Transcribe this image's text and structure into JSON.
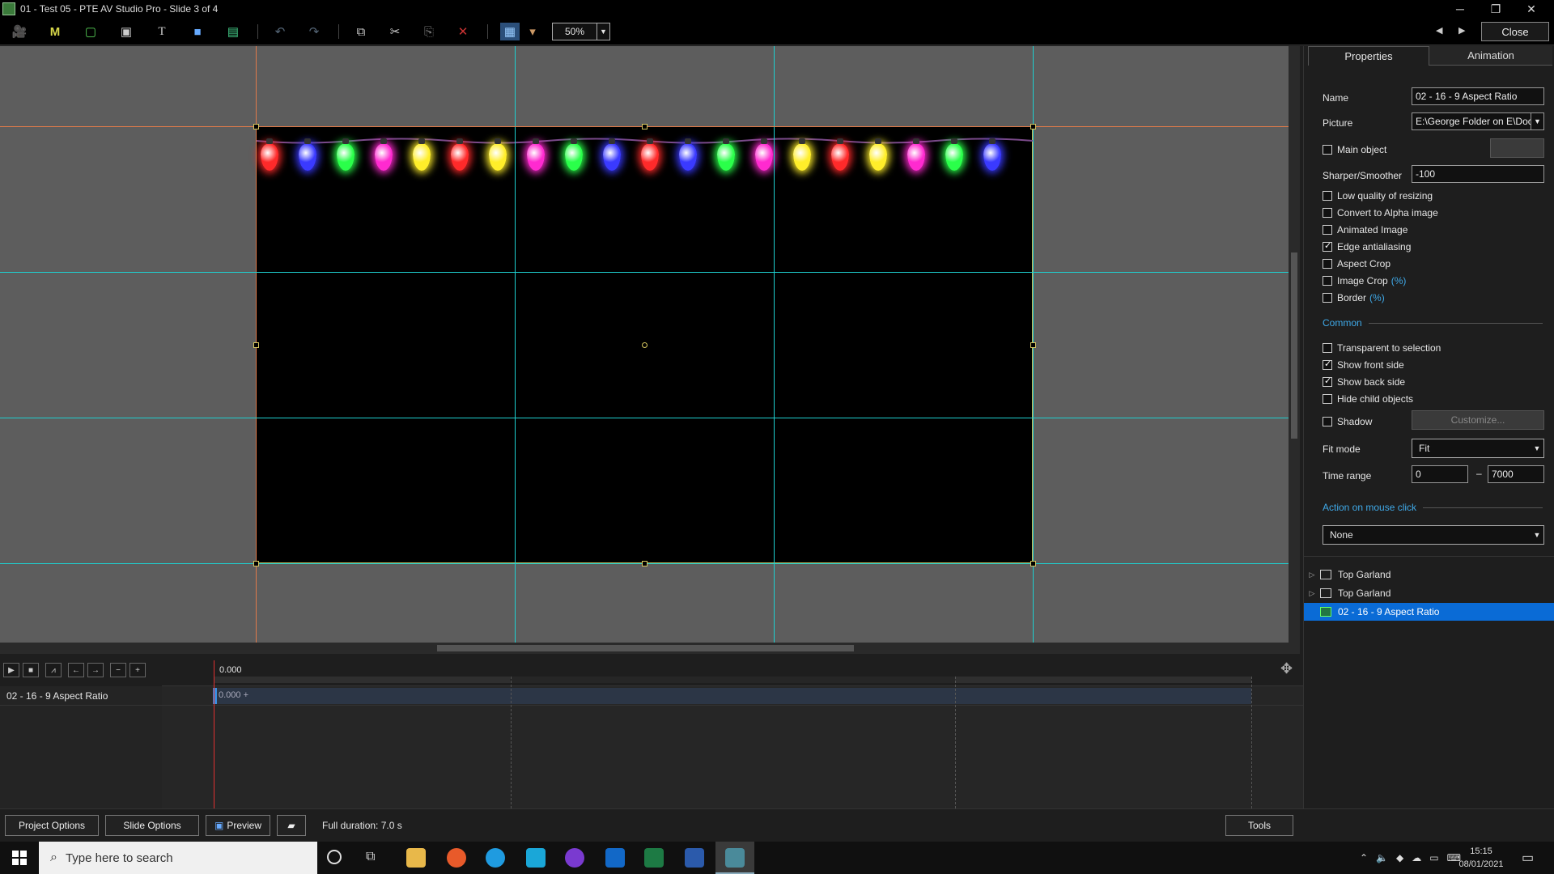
{
  "window": {
    "title": "01 - Test 05 - PTE AV Studio Pro - Slide 3 of 4",
    "minimize": "─",
    "restore": "❐",
    "close": "✕"
  },
  "toolbar": {
    "zoom": "50%",
    "close_label": "Close",
    "prev_arrow": "◀",
    "next_arrow": "▶",
    "icons": {
      "camera": "🎥",
      "mask": "M",
      "frame": "▢",
      "video": "▣",
      "text": "T",
      "rect": "■",
      "image": "▤",
      "undo": "↶",
      "redo": "↷",
      "copy": "⧉",
      "cut": "✂",
      "paste": "⎘",
      "delete": "✕",
      "grid": "▦",
      "grid_dropdown": "▾"
    }
  },
  "properties": {
    "tabs": [
      "Properties",
      "Animation"
    ],
    "name_label": "Name",
    "name_value": "02 - 16 - 9 Aspect Ratio",
    "picture_label": "Picture",
    "picture_value": "E:\\George Folder on E\\Doc",
    "main_object": "Main object",
    "sharper_label": "Sharper/Smoother",
    "sharper_value": "-100",
    "low_quality": "Low quality of resizing",
    "convert_alpha": "Convert to Alpha image",
    "animated_image": "Animated Image",
    "edge_antialiasing": "Edge antialiasing",
    "aspect_crop": "Aspect Crop",
    "image_crop": "Image Crop",
    "image_crop_link": "(%)",
    "border": "Border",
    "border_link": "(%)",
    "common_section": "Common",
    "transparent": "Transparent to selection",
    "show_front": "Show front side",
    "show_back": "Show back side",
    "hide_child": "Hide child objects",
    "shadow": "Shadow",
    "customize": "Customize...",
    "fit_mode_label": "Fit mode",
    "fit_mode_value": "Fit",
    "time_range_label": "Time range",
    "time_from": "0",
    "time_dash": "–",
    "time_to": "7000",
    "action_section": "Action on mouse click",
    "action_value": "None",
    "checked": {
      "main_object": false,
      "low_quality": false,
      "convert_alpha": false,
      "animated_image": false,
      "edge_antialiasing": true,
      "aspect_crop": false,
      "image_crop": false,
      "border": false,
      "transparent": false,
      "show_front": true,
      "show_back": true,
      "hide_child": false,
      "shadow": false
    }
  },
  "object_tree": [
    {
      "label": "Top Garland",
      "selected": false
    },
    {
      "label": "Top Garland",
      "selected": false
    },
    {
      "label": "02 - 16 - 9 Aspect Ratio",
      "selected": true
    }
  ],
  "timeline": {
    "ruler_start": "0.000",
    "track_name": "02 - 16 - 9 Aspect Ratio",
    "clip_label": "0.000 +",
    "controls": [
      "▶",
      "■",
      "⩘",
      "←",
      "→",
      "−",
      "+"
    ]
  },
  "bottombar": {
    "project_options": "Project Options",
    "slide_options": "Slide Options",
    "preview": "Preview",
    "full_duration": "Full duration: 7.0 s",
    "tools": "Tools"
  },
  "taskbar": {
    "search_placeholder": "Type here to search",
    "time": "15:15",
    "date": "08/01/2021"
  },
  "colors": {
    "guide_cyan": "#1fd0d0",
    "guide_orange": "#e07a4a",
    "selection": "#0a6bd6",
    "link": "#3fa9e8"
  },
  "bulbs": [
    "red",
    "blue",
    "green",
    "magenta",
    "yellow",
    "red",
    "yellow",
    "magenta",
    "green",
    "blue",
    "red",
    "blue",
    "green",
    "magenta",
    "yellow",
    "red",
    "yellow",
    "magenta",
    "green",
    "blue"
  ]
}
